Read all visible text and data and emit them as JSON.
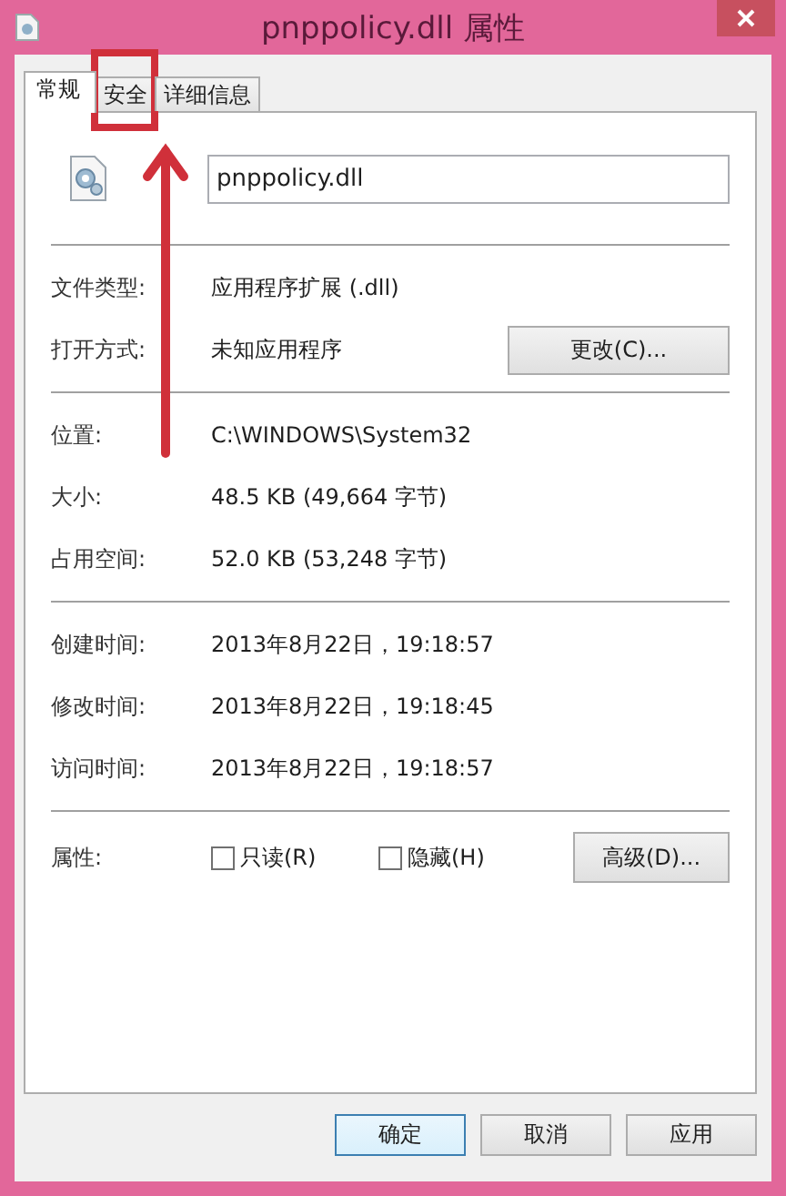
{
  "window": {
    "title": "pnppolicy.dll 属性"
  },
  "tabs": [
    {
      "label": "常规",
      "selected": true,
      "highlighted": false
    },
    {
      "label": "安全",
      "selected": false,
      "highlighted": true
    },
    {
      "label": "详细信息",
      "selected": false,
      "highlighted": false
    }
  ],
  "file_name": {
    "value": "pnppolicy.dll"
  },
  "sections": [
    {
      "rows": [
        {
          "label": "文件类型:",
          "value": "应用程序扩展 (.dll)"
        },
        {
          "label": "打开方式:",
          "value": "未知应用程序",
          "button": "更改(C)..."
        }
      ]
    },
    {
      "rows": [
        {
          "label": "位置:",
          "value": "C:\\WINDOWS\\System32"
        },
        {
          "label": "大小:",
          "value": "48.5 KB (49,664 字节)"
        },
        {
          "label": "占用空间:",
          "value": "52.0 KB (53,248 字节)"
        }
      ]
    },
    {
      "rows": [
        {
          "label": "创建时间:",
          "value": "2013年8月22日，19:18:57"
        },
        {
          "label": "修改时间:",
          "value": "2013年8月22日，19:18:45"
        },
        {
          "label": "访问时间:",
          "value": "2013年8月22日，19:18:57"
        }
      ]
    }
  ],
  "attributes": {
    "label": "属性:",
    "checkboxes": [
      {
        "label": "只读(R)",
        "checked": false
      },
      {
        "label": "隐藏(H)",
        "checked": false
      }
    ],
    "button": "高级(D)..."
  },
  "buttons": [
    {
      "label": "确定",
      "default": true
    },
    {
      "label": "取消",
      "default": false
    },
    {
      "label": "应用",
      "default": false
    }
  ]
}
